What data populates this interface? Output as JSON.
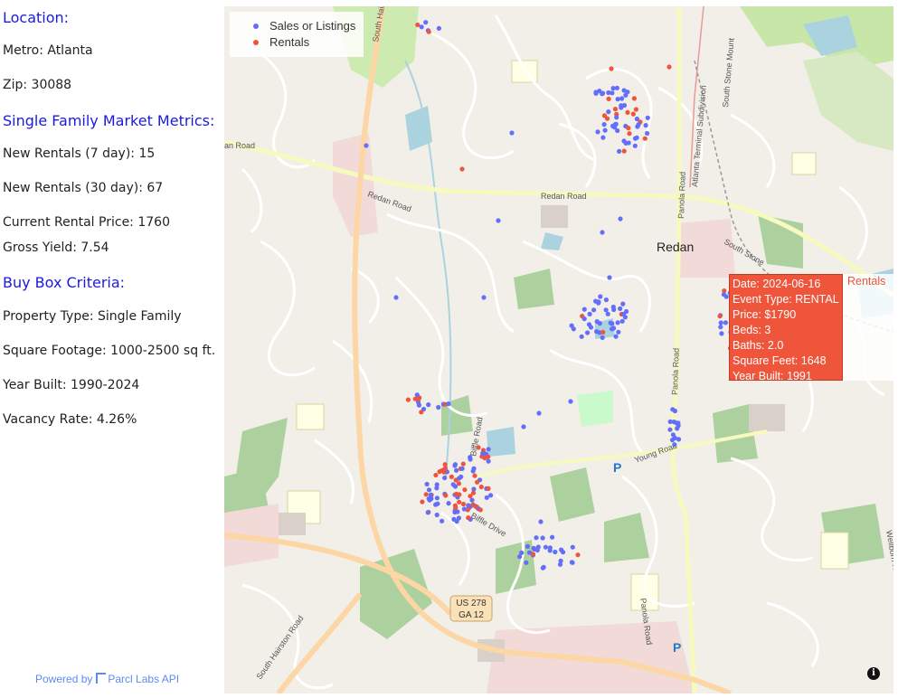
{
  "panel": {
    "location_heading": "Location:",
    "metro": "Metro: Atlanta",
    "zip": "Zip: 30088",
    "metrics_heading": "Single Family Market Metrics:",
    "new_rentals_7": "New Rentals (7 day): 15",
    "new_rentals_30": "New Rentals (30 day): 67",
    "current_rental_price": "Current Rental Price: 1760",
    "gross_yield": "Gross Yield: 7.54",
    "buybox_heading": "Buy Box Criteria:",
    "property_type": "Property Type: Single Family",
    "square_footage": "Square Footage: 1000-2500 sq ft.",
    "year_built": "Year Built: 1990-2024",
    "vacancy_rate": "Vacancy Rate: 4.26%",
    "powered_by": "Powered by",
    "powered_brand": "Parcl Labs API"
  },
  "legend": {
    "sales": {
      "label": "Sales or Listings",
      "color": "#636efa"
    },
    "rentals": {
      "label": "Rentals",
      "color": "#ef553b"
    }
  },
  "tooltip": {
    "date": "Date: 2024-06-16",
    "event_type": "Event Type: RENTAL",
    "price": "Price: $1790",
    "beds": "Beds: 3",
    "baths": "Baths: 2.0",
    "square_feet": "Square Feet: 1648",
    "year_built": "Year Built: 1991",
    "series_name": "Rentals",
    "color": "#ef553b"
  },
  "map_labels": {
    "redan_road_1": "Redan Road",
    "redan_road_2": "Redan Road",
    "redan_road_west": "an Road",
    "redan_town": "Redan",
    "south_hairston_top": "South Hairston",
    "south_hairston_bottom": "South Hairston Road",
    "panola_road_1": "Panola Road",
    "panola_road_2": "Panola Road",
    "panola_road_3": "Panola Road",
    "biffle_road": "Biffle Road",
    "biffle_drive": "Biffle Drive",
    "young_road": "Young Road",
    "south_stone_mountain": "South Stone Mount",
    "atlanta_terminal": "Atlanta Terminal Subdivision",
    "south_stone_lower": "South Stone",
    "wellborn": "Wellborn R",
    "shield_line1": "US 278",
    "shield_line2": "GA 12",
    "parking": "P",
    "info": "i"
  }
}
